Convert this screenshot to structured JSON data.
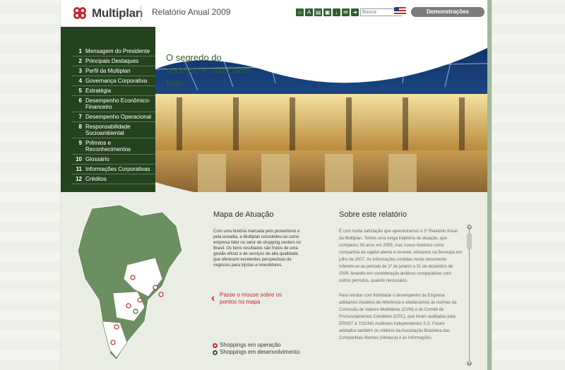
{
  "header": {
    "brand": "Multiplan",
    "report_title": "Relatório Anual 2009",
    "search_placeholder": "Busca:",
    "financial_button": "Demonstrações Financeiras",
    "toolbar_icons": [
      "home-icon",
      "text-size-icon",
      "print-icon",
      "save-icon",
      "download-icon",
      "email-icon",
      "forward-icon"
    ]
  },
  "nav": {
    "items": [
      {
        "num": "1",
        "label": "Mensagem do Presidente"
      },
      {
        "num": "2",
        "label": "Principais Destaques"
      },
      {
        "num": "3",
        "label": "Perfil da Multiplan"
      },
      {
        "num": "4",
        "label": "Governança Corporativa"
      },
      {
        "num": "5",
        "label": "Estratégia"
      },
      {
        "num": "6",
        "label": "Desempenho Econômico-Financeiro"
      },
      {
        "num": "7",
        "label": "Desempenho Operacional"
      },
      {
        "num": "8",
        "label": "Responsabilidade Socioambiental"
      },
      {
        "num": "9",
        "label": "Prêmios e Reconhecimentos"
      },
      {
        "num": "10",
        "label": "Glossário"
      },
      {
        "num": "11",
        "label": "Informações Corporativas"
      },
      {
        "num": "12",
        "label": "Créditos"
      }
    ]
  },
  "hero": {
    "tagline": "O segredo do sucesso é fazer bem feito"
  },
  "map_section": {
    "title": "Mapa de Atuação",
    "text": "Com uma história marcada pelo pioneirismo e pela ousadia, a Multiplan consolidou-se como empresa líder no setor de shopping centers no Brasil. Os bons resultados são frutos de uma gestão eficaz e de serviços de alta qualidade, que oferecem excelentes perspectivas de negócios para lojistas e investidores.",
    "hover_hint": "Passe o mouse sobre os pontos no mapa",
    "legend_operating": "Shoppings em operação",
    "legend_developing": "Shoppings em desenvolvimento"
  },
  "about_section": {
    "title": "Sobre este relatório",
    "paragraph1": "É com muita satisfação que apresentamos o 2º Relatório Anual da Multiplan. Temos uma longa trajetória de atuação, que completou 34 anos em 2009, mas nosso histórico como companhia de capital aberto é recente: entramos na Bovespa em julho de 2007. As informações contidas neste documento referem-se ao período de 1º de janeiro a 31 de dezembro de 2009, levando em consideração análises comparativas com outros períodos, quando necessário.",
    "paragraph2": "Para retratar com fidelidade o desempenho da Empresa adotamos modelos de referência e obedecemos às normas da Comissão de Valores Mobiliários (CVM) e do Comitê de Pronunciamentos Contábeis (CPC), que foram auditadas pela ERNST & YOUNG Auditores Independentes S.S. Foram adotados também os critérios da Associação Brasileira das Companhias Abertas (Abrasca) e às informações"
  },
  "colors": {
    "brand_green": "#25421f",
    "accent_red": "#c0282d",
    "bg_light": "#e9ede3"
  }
}
